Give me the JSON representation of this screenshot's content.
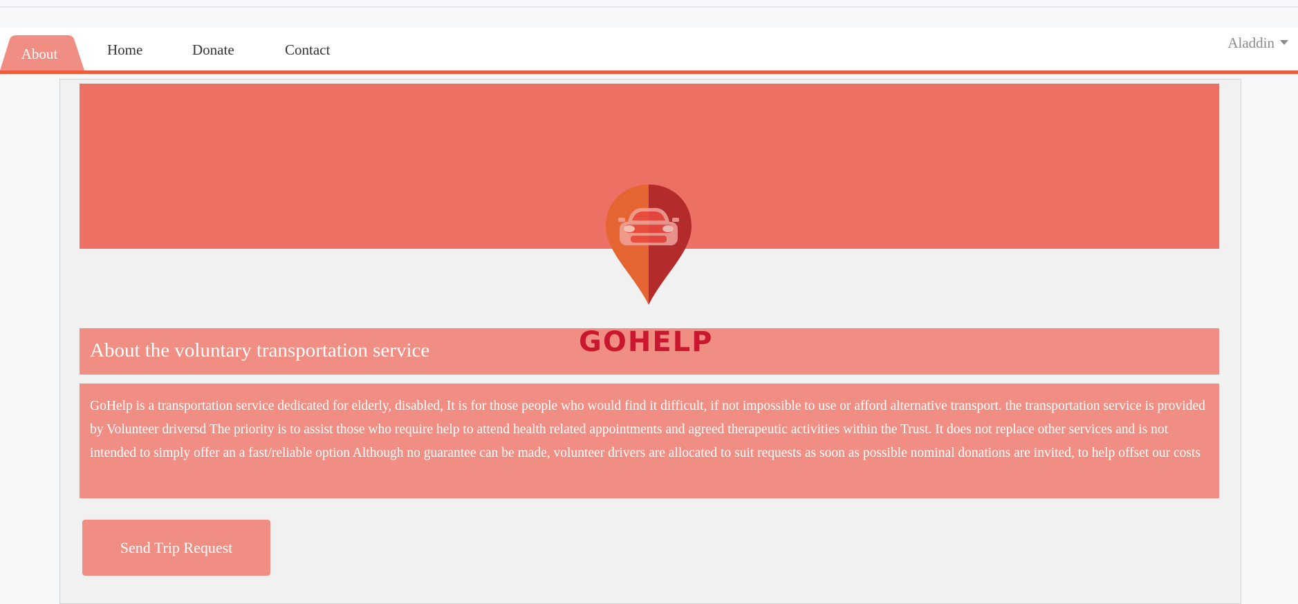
{
  "nav": {
    "tabs": [
      {
        "label": "About",
        "active": true
      },
      {
        "label": "Home"
      },
      {
        "label": "Donate"
      },
      {
        "label": "Contact"
      }
    ],
    "user_name": "Aladdin"
  },
  "colors": {
    "accent": "#ee5c3c",
    "banner": "#ec7164",
    "panel": "#f18e84",
    "brand_text": "#c8172f"
  },
  "logo": {
    "icon": "car-location-pin-icon",
    "text": "GOHELP"
  },
  "about": {
    "title": "About the voluntary transportation service",
    "description": "GoHelp is a transportation service dedicated for elderly, disabled, It is for those people who would find it difficult, if not impossible to use or afford alternative transport. the transportation service is provided by Volunteer driversd The priority is to assist those who require help to attend health related appointments and agreed therapeutic activities within the Trust. It does not replace other services and is not intended to simply offer an a fast/reliable option Although no guarantee can be made, volunteer drivers are allocated to suit requests as soon as possible nominal donations are invited, to help offset our costs"
  },
  "actions": {
    "send_trip_request": "Send Trip Request"
  }
}
